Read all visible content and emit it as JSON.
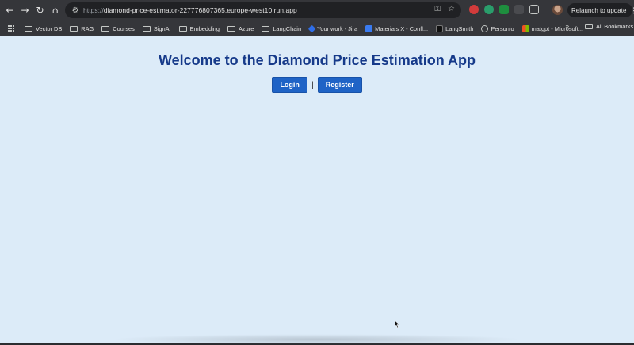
{
  "browser": {
    "url_scheme": "https://",
    "url_host": "diamond-price-estimator-227776807365.europe-west10.run.app",
    "relaunch_label": "Relaunch to update",
    "bookmarks": [
      {
        "label": "Vector DB",
        "icon": "folder-icon"
      },
      {
        "label": "RAG",
        "icon": "folder-icon"
      },
      {
        "label": "Courses",
        "icon": "folder-icon"
      },
      {
        "label": "SignAI",
        "icon": "folder-icon"
      },
      {
        "label": "Embedding",
        "icon": "folder-icon"
      },
      {
        "label": "Azure",
        "icon": "folder-icon"
      },
      {
        "label": "LangChain",
        "icon": "folder-icon"
      },
      {
        "label": "Your work - Jira",
        "icon": "jira-icon"
      },
      {
        "label": "Materials X - Confl...",
        "icon": "confluence-icon"
      },
      {
        "label": "LangSmith",
        "icon": "langsmith-icon"
      },
      {
        "label": "Personio",
        "icon": "personio-icon"
      },
      {
        "label": "matgpt - Microsoft...",
        "icon": "microsoft-icon"
      }
    ],
    "all_bookmarks_label": "All Bookmarks"
  },
  "page": {
    "title": "Welcome to the Diamond Price Estimation App",
    "login_label": "Login",
    "separator": "|",
    "register_label": "Register"
  },
  "colors": {
    "background": "#dcebf8",
    "title": "#163a8a",
    "button": "#1f63c6"
  }
}
